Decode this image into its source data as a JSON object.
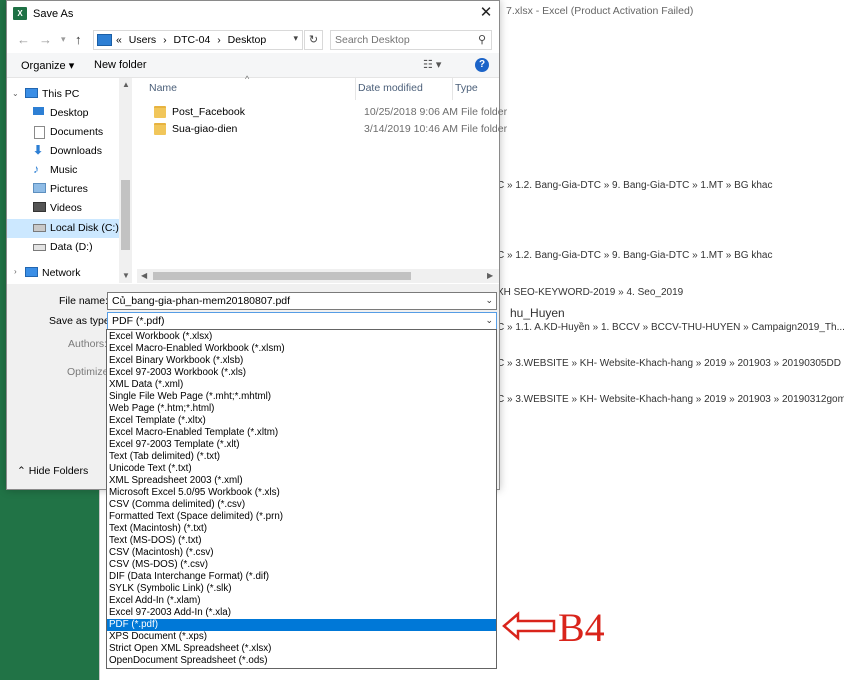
{
  "background": {
    "window_title": "7.xlsx - Excel (Product Activation Failed)",
    "lines": [
      {
        "text": "C » 1.2. Bang-Gia-DTC » 9. Bang-Gia-DTC » 1.MT » BG khac"
      },
      {
        "text": "C » 1.2. Bang-Gia-DTC » 9. Bang-Gia-DTC » 1.MT » BG khac"
      },
      {
        "text": "XH SEO-KEYWORD-2019 » 4. Seo_2019"
      },
      {
        "text": "hu_Huyen"
      },
      {
        "text": "C » 1.1. A.KD-Huyền » 1. BCCV » BCCV-THU-HUYEN » Campaign2019_Th..."
      },
      {
        "text": "C » 3.WEBSITE » KH- Website-Khach-hang » 2019 » 201903 » 20190305DD"
      },
      {
        "text": "C » 3.WEBSITE » KH- Website-Khach-hang » 2019 » 201903 » 20190312gom"
      }
    ]
  },
  "dialog": {
    "title": "Save As",
    "app_icon_text": "X",
    "close_glyph": "✕",
    "address": {
      "overflow": "«",
      "segments": [
        "Users",
        "DTC-04",
        "Desktop"
      ],
      "separator": "›"
    },
    "search_placeholder": "Search Desktop",
    "toolbar": {
      "organize": "Organize ▾",
      "new_folder": "New folder",
      "help": "?"
    },
    "nav": [
      {
        "label": "This PC",
        "icon": "computer-icon"
      },
      {
        "label": "Desktop",
        "icon": "desktop-icon"
      },
      {
        "label": "Documents",
        "icon": "documents-icon"
      },
      {
        "label": "Downloads",
        "icon": "downloads-icon"
      },
      {
        "label": "Music",
        "icon": "music-icon"
      },
      {
        "label": "Pictures",
        "icon": "pictures-icon"
      },
      {
        "label": "Videos",
        "icon": "videos-icon"
      },
      {
        "label": "Local Disk (C:)",
        "icon": "local-disk-icon"
      },
      {
        "label": "Data (D:)",
        "icon": "data-drive-icon"
      },
      {
        "label": "Network",
        "icon": "network-icon"
      }
    ],
    "columns": {
      "name": "Name",
      "date": "Date modified",
      "type": "Type"
    },
    "files": [
      {
        "name": "Post_Facebook",
        "date": "10/25/2018 9:06 AM",
        "type": "File folder"
      },
      {
        "name": "Sua-giao-dien",
        "date": "3/14/2019 10:46 AM",
        "type": "File folder"
      }
    ],
    "form": {
      "file_name_label": "File name:",
      "file_name_value": "Củ_bang-gia-phan-mem20180807.pdf",
      "save_type_label": "Save as type:",
      "save_type_value": "PDF (*.pdf)",
      "authors_label": "Authors:",
      "optimize_label": "Optimize",
      "hide_folders": "Hide Folders"
    },
    "type_options": [
      "Excel Workbook (*.xlsx)",
      "Excel Macro-Enabled Workbook (*.xlsm)",
      "Excel Binary Workbook (*.xlsb)",
      "Excel 97-2003 Workbook (*.xls)",
      "XML Data (*.xml)",
      "Single File Web Page (*.mht;*.mhtml)",
      "Web Page (*.htm;*.html)",
      "Excel Template (*.xltx)",
      "Excel Macro-Enabled Template (*.xltm)",
      "Excel 97-2003 Template (*.xlt)",
      "Text (Tab delimited) (*.txt)",
      "Unicode Text (*.txt)",
      "XML Spreadsheet 2003 (*.xml)",
      "Microsoft Excel 5.0/95 Workbook (*.xls)",
      "CSV (Comma delimited) (*.csv)",
      "Formatted Text (Space delimited) (*.prn)",
      "Text (Macintosh) (*.txt)",
      "Text (MS-DOS) (*.txt)",
      "CSV (Macintosh) (*.csv)",
      "CSV (MS-DOS) (*.csv)",
      "DIF (Data Interchange Format) (*.dif)",
      "SYLK (Symbolic Link) (*.slk)",
      "Excel Add-In (*.xlam)",
      "Excel 97-2003 Add-In (*.xla)",
      "PDF (*.pdf)",
      "XPS Document (*.xps)",
      "Strict Open XML Spreadsheet (*.xlsx)",
      "OpenDocument Spreadsheet (*.ods)"
    ],
    "selected_type_index": 24
  },
  "annotation": {
    "label": "B4",
    "color": "#d9241b"
  }
}
